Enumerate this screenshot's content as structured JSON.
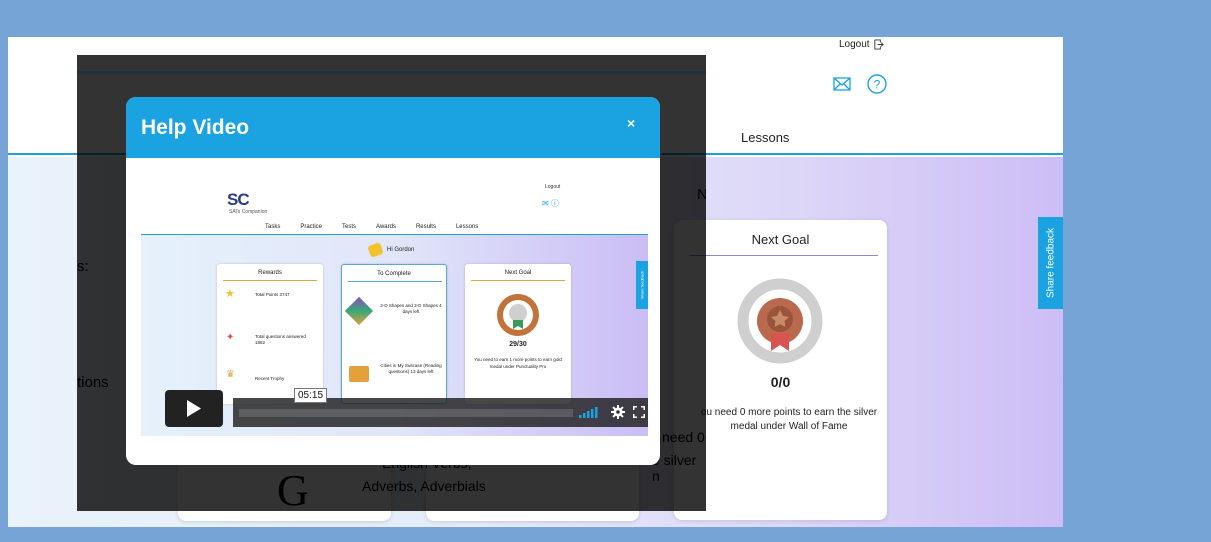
{
  "header": {
    "logout_label": "Logout",
    "nav_lessons": "Lessons"
  },
  "share_feedback": "Share feedback",
  "next_goal_card": {
    "title": "Next Goal",
    "score": "0/0",
    "text": "ou need 0 more points to earn the silver medal under Wall of Fame"
  },
  "background_fragments": {
    "s_colon": "s:",
    "tions": "tions",
    "n_letter": "N",
    "need": "need 0",
    "silver": "e silver n",
    "english": "English Verbs,",
    "adverbs": "Adverbs, Adverbials",
    "g_letter": "G"
  },
  "modal": {
    "title": "Help Video",
    "close_label": "×"
  },
  "video": {
    "timestamp": "05:15",
    "logo": "SC",
    "logo_sub": "SATs Companion",
    "logout": "Logout",
    "nav": [
      "Tasks",
      "Practice",
      "Tests",
      "Awards",
      "Results",
      "Lessons"
    ],
    "greeting": "Hi Gordon",
    "rewards": {
      "title": "Rewards",
      "items": [
        "Total Points 3747",
        "Total questions answered 1882",
        "Recent Trophy"
      ]
    },
    "to_complete": {
      "title": "To Complete",
      "items": [
        "2-D Shapes and 3-D Shapes 4 days left",
        "Cities in My Suitcase (Reading questions) 13 days left"
      ]
    },
    "next_goal": {
      "title": "Next Goal",
      "score": "29/30",
      "text": "You need to earn 1 more points to earn gold medal under Punctuality Pro"
    },
    "share": "Share feedback"
  },
  "colors": {
    "accent": "#1aa3e0",
    "page_bg": "#76a4d6"
  }
}
